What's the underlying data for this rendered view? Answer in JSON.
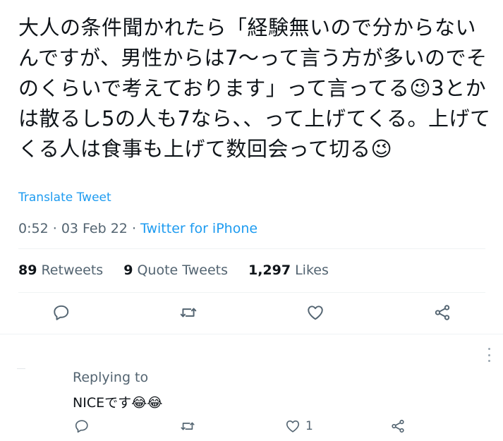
{
  "tweet": {
    "text": "大人の条件聞かれたら「経験無いので分からないんですが、男性からは7〜って言う方が多いのでそのくらいで考えております」って言ってる😉3とかは散るし5の人も7なら、、って上げてくる。上げてくる人は食事も上げて数回会って切る😉",
    "translate_label": "Translate Tweet",
    "time": "0:52",
    "date": "03 Feb 22",
    "dot": "·",
    "source": "Twitter for iPhone"
  },
  "stats": {
    "retweets_count": "89",
    "retweets_label": "Retweets",
    "quotes_count": "9",
    "quotes_label": "Quote Tweets",
    "likes_count": "1,297",
    "likes_label": "Likes"
  },
  "actions": [
    "comment-icon",
    "retweet-icon",
    "heart-icon",
    "share-icon"
  ],
  "reply": {
    "replying_label": "Replying to",
    "text": "NICEです😂😂",
    "like_count": "1"
  },
  "colors": {
    "link": "#1d9bf0",
    "muted": "#536471",
    "text": "#0f1419",
    "divider": "#eff3f4"
  }
}
